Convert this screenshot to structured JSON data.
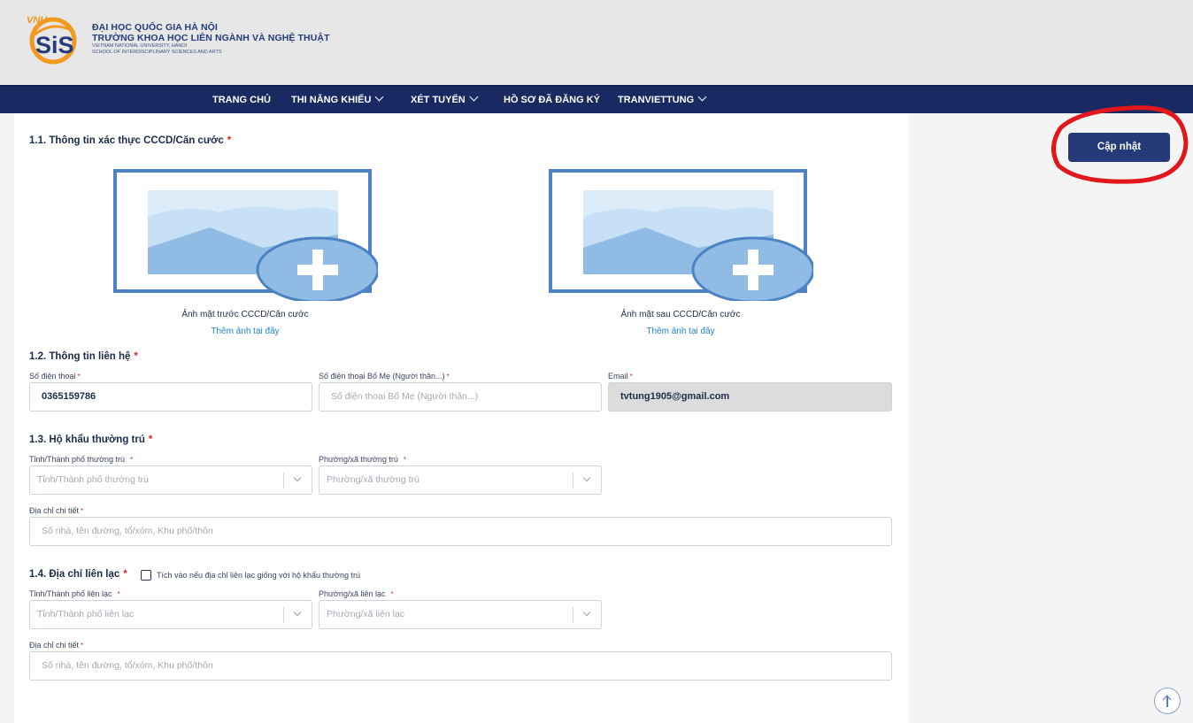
{
  "header": {
    "line1": "ĐẠI HỌC QUỐC GIA HÀ NỘI",
    "line2": "TRƯỜNG KHOA HỌC LIÊN NGÀNH VÀ NGHỆ THUẬT",
    "line3": "VIETNAM NATIONAL UNIVERSITY, HANOI",
    "line4": "SCHOOL OF INTERDISCIPLINARY SCIENCES AND ARTS",
    "logo_letters": "SiS",
    "logo_small": "VNU"
  },
  "nav": {
    "items": [
      {
        "label": "TRANG CHỦ"
      },
      {
        "label": "THI NĂNG KHIẾU"
      },
      {
        "label": "XÉT TUYỂN"
      },
      {
        "label": "HỒ SƠ ĐÃ ĐĂNG KÝ"
      },
      {
        "label": "TRANVIETTUNG"
      }
    ]
  },
  "form": {
    "s1": {
      "title": "1.1. Thông tin xác thực CCCD/Căn cước",
      "front_caption": "Ảnh mặt trước CCCD/Căn cước",
      "back_caption": "Ảnh mặt sau CCCD/Căn cước",
      "add_link": "Thêm ảnh tại đây"
    },
    "s2": {
      "title": "1.2. Thông tin liên hệ",
      "phone_label": "Số điện thoại",
      "phone_value": "0365159786",
      "parent_phone_label": "Số điện thoại Bố Mẹ (Người thân...)",
      "parent_phone_placeholder": "Số điện thoại Bố Mẹ (Người thân...)",
      "email_label": "Email",
      "email_value": "tvtung1905@gmail.com"
    },
    "s3": {
      "title": "1.3. Hộ khẩu thường trú",
      "province_label": "Tỉnh/Thành phố thường trú",
      "province_placeholder": "Tỉnh/Thành phố thường trú",
      "ward_label": "Phường/xã thường trú",
      "ward_placeholder": "Phường/xã thường trú",
      "address_label": "Địa chỉ chi tiết",
      "address_placeholder": "Số nhà, tên đường, tổ/xóm, Khu phố/thôn"
    },
    "s4": {
      "title": "1.4. Địa chỉ liên lạc",
      "checkbox_label": "Tích vào nếu địa chỉ liên lạc giống với hộ khẩu thường trú",
      "checked": false,
      "province_label": "Tỉnh/Thành phố liên lạc",
      "province_placeholder": "Tỉnh/Thành phố liên lạc",
      "ward_label": "Phường/xã liên lạc",
      "ward_placeholder": "Phường/xã liên lạc",
      "address_label": "Địa chỉ chi tiết",
      "address_placeholder": "Số nhà, tên đường, tổ/xóm, Khu phố/thôn"
    },
    "required_mark": "*"
  },
  "actions": {
    "update_label": "Cập nhật"
  },
  "colors": {
    "nav_bg": "#192a62",
    "primary_btn": "#253a78",
    "link": "#2583c8",
    "required": "#e0282e",
    "annotation": "#e2161b"
  },
  "icons": {
    "upload": "image-plus-icon",
    "select_arrow": "chevron-down-icon",
    "scroll_top": "arrow-up-icon"
  }
}
